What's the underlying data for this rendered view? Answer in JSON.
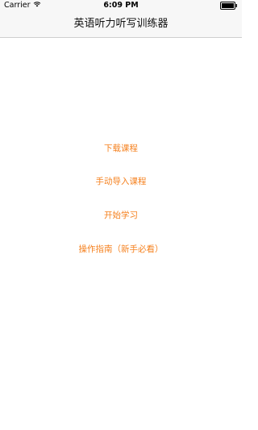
{
  "status_bar": {
    "carrier": "Carrier",
    "time": "6:09 PM",
    "wifi_icon": "wifi-icon",
    "battery_icon": "battery-icon"
  },
  "nav": {
    "title": "英语听力听写训练器"
  },
  "menu": {
    "download_label": "下载课程",
    "import_label": "手动导入课程",
    "start_label": "开始学习",
    "guide_label": "操作指南（新手必看）"
  },
  "colors": {
    "accent": "#f5811f",
    "bar_background": "#f7f7f7"
  }
}
